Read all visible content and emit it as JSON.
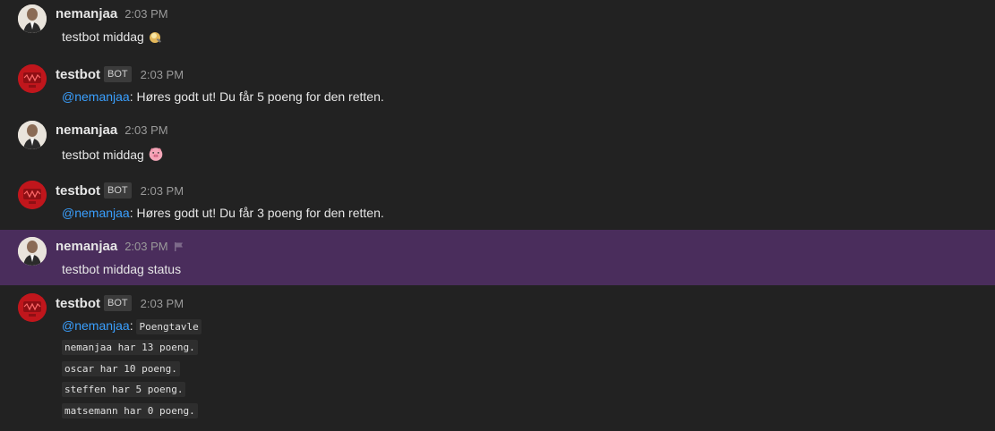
{
  "messages": [
    {
      "author": "nemanjaa",
      "time": "2:03 PM",
      "text": "testbot middag",
      "emoji": "pancake-emoji"
    },
    {
      "author": "testbot",
      "badge": "BOT",
      "time": "2:03 PM",
      "mention": "@nemanjaa",
      "text": ": Høres godt ut! Du får 5 poeng for den retten."
    },
    {
      "author": "nemanjaa",
      "time": "2:03 PM",
      "text": "testbot middag",
      "emoji": "pig-face-emoji"
    },
    {
      "author": "testbot",
      "badge": "BOT",
      "time": "2:03 PM",
      "mention": "@nemanjaa",
      "text": ": Høres godt ut! Du får 3 poeng for den retten."
    },
    {
      "author": "nemanjaa",
      "time": "2:03 PM",
      "text": "testbot middag status"
    },
    {
      "author": "testbot",
      "badge": "BOT",
      "time": "2:03 PM",
      "mention": "@nemanjaa",
      "sep": ":",
      "code_lines": [
        "Poengtavle",
        "nemanjaa har 13 poeng.",
        "oscar har 10 poeng.",
        "steffen har 5 poeng.",
        "matsemann har 0 poeng."
      ]
    }
  ],
  "colors": {
    "background": "#222222",
    "highlight": "#4a2d5c",
    "mention": "#3aa0ff",
    "bot_avatar": "#c0161c"
  }
}
